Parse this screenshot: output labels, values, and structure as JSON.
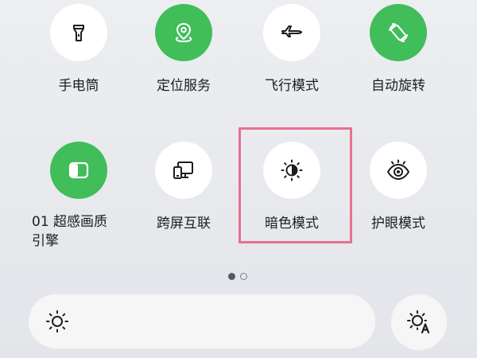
{
  "tiles": [
    {
      "label": "手电筒",
      "icon": "flashlight-icon",
      "active": false
    },
    {
      "label": "定位服务",
      "icon": "location-pin-icon",
      "active": true
    },
    {
      "label": "飞行模式",
      "icon": "airplane-icon",
      "active": false
    },
    {
      "label": "自动旋转",
      "icon": "auto-rotate-icon",
      "active": true
    },
    {
      "label": "01 超感画质引擎",
      "icon": "display-engine-icon",
      "active": true
    },
    {
      "label": "跨屏互联",
      "icon": "multi-screen-icon",
      "active": false
    },
    {
      "label": "暗色模式",
      "icon": "dark-mode-icon",
      "active": false
    },
    {
      "label": "护眼模式",
      "icon": "eye-comfort-icon",
      "active": false
    }
  ],
  "pager": {
    "count": 2,
    "active_index": 0
  },
  "brightness": {
    "icon": "brightness-sun-icon"
  },
  "auto_brightness": {
    "icon": "auto-brightness-icon"
  },
  "colors": {
    "active_tile": "#41bd5a",
    "inactive_tile": "#ffffff",
    "highlight_border": "#e8708f"
  }
}
